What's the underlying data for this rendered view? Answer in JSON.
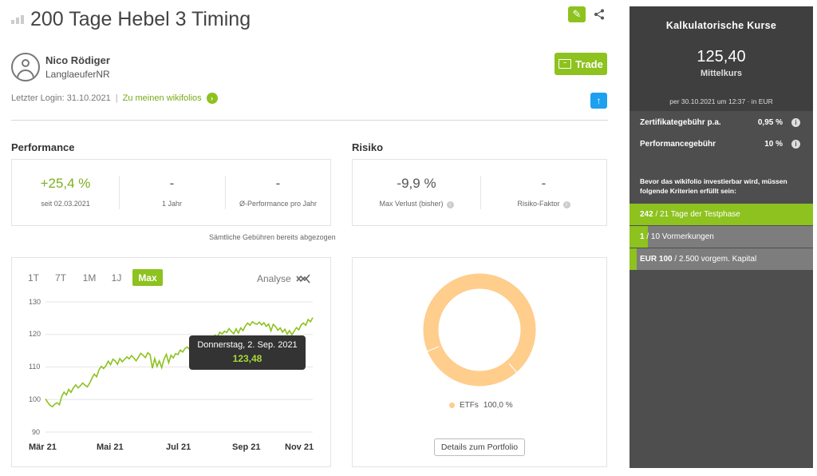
{
  "header": {
    "title": "200 Tage Hebel 3 Timing",
    "edit_icon": "pencil-icon",
    "share_icon": "share-icon"
  },
  "trader": {
    "name": "Nico Rödiger",
    "handle": "LanglaeuferNR",
    "last_login_label": "Letzter Login: 31.10.2021",
    "separator": "|",
    "wikifolios_link": "Zu meinen wikifolios",
    "trade_label": "Trade"
  },
  "performance": {
    "heading": "Performance",
    "metrics": [
      {
        "value": "+25,4 %",
        "label": "seit 02.03.2021"
      },
      {
        "value": "-",
        "label": "1 Jahr"
      },
      {
        "value": "-",
        "label": "Ø-Performance pro Jahr"
      }
    ],
    "fee_note": "Sämtliche Gebühren bereits abgezogen"
  },
  "risk": {
    "heading": "Risiko",
    "metrics": [
      {
        "value": "-9,9 %",
        "label": "Max Verlust (bisher)"
      },
      {
        "value": "-",
        "label": "Risiko-Faktor"
      }
    ]
  },
  "chart_controls": {
    "ranges": [
      "1T",
      "7T",
      "1M",
      "1J",
      "Max"
    ],
    "active_range": "Max",
    "analyse_label": "Analyse"
  },
  "chart_data": {
    "type": "line",
    "ylim": [
      90,
      130
    ],
    "yticks": [
      130,
      120,
      110,
      100,
      90
    ],
    "x_labels": [
      "Mär 21",
      "Mai 21",
      "Jul 21",
      "Sep 21",
      "Nov 21"
    ],
    "series": [
      {
        "color": "#8dc21f",
        "values": [
          100.2,
          99.1,
          98.2,
          97.8,
          98.6,
          99.0,
          98.4,
          101.0,
          102.3,
          101.4,
          103.1,
          102.2,
          103.6,
          104.5,
          103.6,
          104.2,
          105.1,
          104.4,
          103.9,
          105.0,
          106.6,
          107.8,
          107.0,
          109.1,
          110.2,
          109.5,
          110.4,
          111.8,
          110.7,
          112.4,
          111.9,
          110.8,
          112.6,
          111.6,
          112.3,
          113.1,
          112.5,
          113.5,
          112.8,
          111.9,
          113.0,
          114.2,
          113.6,
          112.9,
          114.4,
          113.8,
          109.6,
          112.6,
          110.2,
          111.9,
          109.8,
          112.4,
          113.9,
          111.3,
          113.6,
          112.8,
          114.1,
          113.8,
          115.2,
          114.6,
          115.7,
          116.1,
          115.4,
          115.9,
          117.1,
          116.7,
          117.4,
          118.5,
          117.8,
          118.9,
          118.2,
          117.7,
          119.0,
          119.8,
          119.3,
          120.7,
          120.1,
          121.0,
          120.6,
          121.8,
          120.9,
          120.2,
          121.7,
          120.4,
          122.0,
          121.2,
          122.6,
          123.5,
          122.8,
          123.9,
          123.4,
          123.1,
          123.8,
          122.9,
          123.6,
          122.5,
          123.2,
          121.1,
          123.1,
          122.4,
          121.3,
          122.0,
          120.7,
          121.6,
          120.1,
          121.2,
          119.9,
          121.0,
          122.1,
          121.4,
          122.9,
          123.5,
          122.8,
          124.6,
          123.9,
          125.2
        ]
      }
    ],
    "tooltip": {
      "date": "Donnerstag, 2. Sep. 2021",
      "value": "123,48"
    }
  },
  "portfolio": {
    "chart_data": {
      "type": "pie",
      "slices": [
        {
          "label": "ETFs",
          "value": 100.0,
          "color": "#ffcd8c"
        }
      ]
    },
    "legend_label": "ETFs",
    "legend_value": "100,0 %",
    "details_button": "Details zum Portfolio"
  },
  "side_panel": {
    "title": "Kalkulatorische Kurse",
    "price": "125,40",
    "price_label": "Mittelkurs",
    "date_note": "per 30.10.2021 um 12:37 · in EUR",
    "fees": [
      {
        "label": "Zertifikategebühr p.a.",
        "value": "0,95 %"
      },
      {
        "label": "Performancegebühr",
        "value": "10 %"
      }
    ],
    "criteria_note": "Bevor das wikifolio investierbar wird, müssen folgende Kriterien erfüllt sein:",
    "criteria": [
      {
        "bold": "242",
        "rest": " / 21 Tage der Testphase",
        "progress": 1.0
      },
      {
        "bold": "1",
        "rest": " / 10 Vormerkungen",
        "progress": 0.1
      },
      {
        "bold": "EUR 100",
        "rest": " / 2.500 vorgem. Kapital",
        "progress": 0.04
      }
    ]
  }
}
